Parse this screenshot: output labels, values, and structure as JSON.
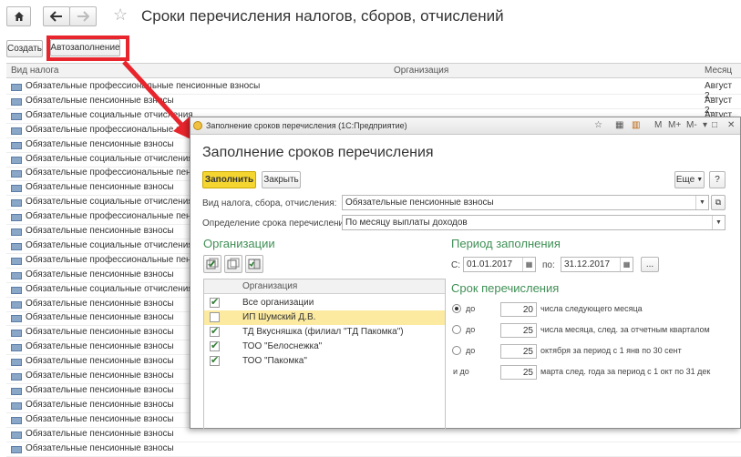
{
  "window": {
    "title": "Сроки перечисления налогов, сборов, отчислений",
    "icons": [
      "home-icon",
      "back-arrow-icon",
      "forward-arrow-icon",
      "star-icon"
    ]
  },
  "toolbar": {
    "create_label": "Создать",
    "autofill_label": "Автозаполнение"
  },
  "list": {
    "columns": [
      "Вид налога",
      "Организация",
      "Месяц"
    ],
    "rows": [
      {
        "tax": "Обязательные профессиональные пенсионные взносы",
        "month": "Август 2..."
      },
      {
        "tax": "Обязательные пенсионные взносы",
        "month": "Август 2..."
      },
      {
        "tax": "Обязательные социальные отчисления",
        "month": "Август 2..."
      },
      {
        "tax": "Обязательные профессиональные пенсионные взносы",
        "month": ""
      },
      {
        "tax": "Обязательные пенсионные взносы",
        "month": ""
      },
      {
        "tax": "Обязательные социальные отчисления",
        "month": ""
      },
      {
        "tax": "Обязательные профессиональные пенсионные взносы",
        "month": ""
      },
      {
        "tax": "Обязательные пенсионные взносы",
        "month": ""
      },
      {
        "tax": "Обязательные социальные отчисления",
        "month": ""
      },
      {
        "tax": "Обязательные профессиональные пенсионные взносы",
        "month": ""
      },
      {
        "tax": "Обязательные пенсионные взносы",
        "month": ""
      },
      {
        "tax": "Обязательные социальные отчисления",
        "month": ""
      },
      {
        "tax": "Обязательные профессиональные пенсионные взносы",
        "month": ""
      },
      {
        "tax": "Обязательные пенсионные взносы",
        "month": ""
      },
      {
        "tax": "Обязательные социальные отчисления",
        "month": ""
      },
      {
        "tax": "Обязательные пенсионные взносы",
        "month": ""
      },
      {
        "tax": "Обязательные пенсионные взносы",
        "month": ""
      },
      {
        "tax": "Обязательные пенсионные взносы",
        "month": ""
      },
      {
        "tax": "Обязательные пенсионные взносы",
        "month": ""
      },
      {
        "tax": "Обязательные пенсионные взносы",
        "month": ""
      },
      {
        "tax": "Обязательные пенсионные взносы",
        "month": ""
      },
      {
        "tax": "Обязательные пенсионные взносы",
        "month": ""
      },
      {
        "tax": "Обязательные пенсионные взносы",
        "month": ""
      },
      {
        "tax": "Обязательные пенсионные взносы",
        "month": ""
      },
      {
        "tax": "Обязательные пенсионные взносы",
        "month": ""
      },
      {
        "tax": "Обязательные пенсионные взносы",
        "month": ""
      }
    ]
  },
  "dialog": {
    "window_title": "Заполнение сроков перечисления (1С:Предприятие)",
    "title": "Заполнение сроков перечисления",
    "titlebar_buttons": [
      "M",
      "M+",
      "M-"
    ],
    "fill_label": "Заполнить",
    "close_label": "Закрыть",
    "more_label": "Еще",
    "help_label": "?",
    "tax_type_label": "Вид налога, сбора, отчисления:",
    "tax_type_value": "Обязательные пенсионные взносы",
    "deadline_label": "Определение срока перечисления:",
    "deadline_value": "По месяцу выплаты доходов",
    "orgs_section": "Организации",
    "orgs_column": "Организация",
    "orgs": [
      {
        "name": "Все организации",
        "checked": true
      },
      {
        "name": "ИП Шумский Д.В.",
        "checked": false
      },
      {
        "name": "ТД Вкусняшка (филиал \"ТД Пакомка\")",
        "checked": true
      },
      {
        "name": "ТОО \"Белоснежка\"",
        "checked": true
      },
      {
        "name": "ТОО \"Пакомка\"",
        "checked": true
      }
    ],
    "period_section": "Период заполнения",
    "period_from_label": "С:",
    "period_from": "01.01.2017",
    "period_to_label": "по:",
    "period_to": "31.12.2017",
    "period_more": "...",
    "term_section": "Срок перечисления",
    "terms": [
      {
        "prefix": "до",
        "value": "20",
        "desc": "числа следующего месяца",
        "selected": true
      },
      {
        "prefix": "до",
        "value": "25",
        "desc": "числа месяца, след. за отчетным кварталом",
        "selected": false
      },
      {
        "prefix": "до",
        "value": "25",
        "desc": "октября за период с 1 янв по 30 сент",
        "selected": false
      },
      {
        "prefix": "и до",
        "value": "25",
        "desc": "марта след. года за период с 1 окт по 31 дек",
        "selected": false
      }
    ],
    "accent_color": "#f5d630",
    "section_color": "#3f8f55"
  },
  "annotation": {
    "highlight_color": "#e8252c"
  }
}
